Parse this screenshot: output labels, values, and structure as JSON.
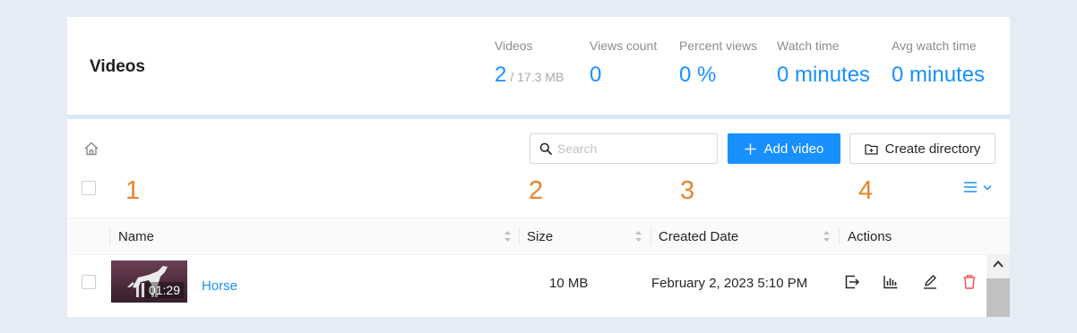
{
  "header": {
    "title": "Videos"
  },
  "stats": [
    {
      "label": "Videos",
      "value": "2",
      "sub": "/ 17.3 MB"
    },
    {
      "label": "Views count",
      "value": "0"
    },
    {
      "label": "Percent views",
      "value": "0 %"
    },
    {
      "label": "Watch time",
      "value": "0 minutes"
    },
    {
      "label": "Avg watch time",
      "value": "0 minutes"
    }
  ],
  "toolbar": {
    "search_placeholder": "Search",
    "search_value": "",
    "add_video_label": "Add video",
    "create_directory_label": "Create directory"
  },
  "annotations": [
    "1",
    "2",
    "3",
    "4"
  ],
  "table": {
    "columns": [
      "Name",
      "Size",
      "Created Date",
      "Actions"
    ],
    "rows": [
      {
        "name": "Horse",
        "duration": "01:29",
        "size": "10 MB",
        "created": "February 2, 2023 5:10 PM",
        "actions": [
          "export-icon",
          "analytics-icon",
          "edit-icon",
          "delete-icon"
        ]
      }
    ]
  },
  "colors": {
    "accent": "#1890ff",
    "annotation": "#e8842a",
    "danger": "#ff4d4f",
    "background": "#e6ecf5"
  }
}
